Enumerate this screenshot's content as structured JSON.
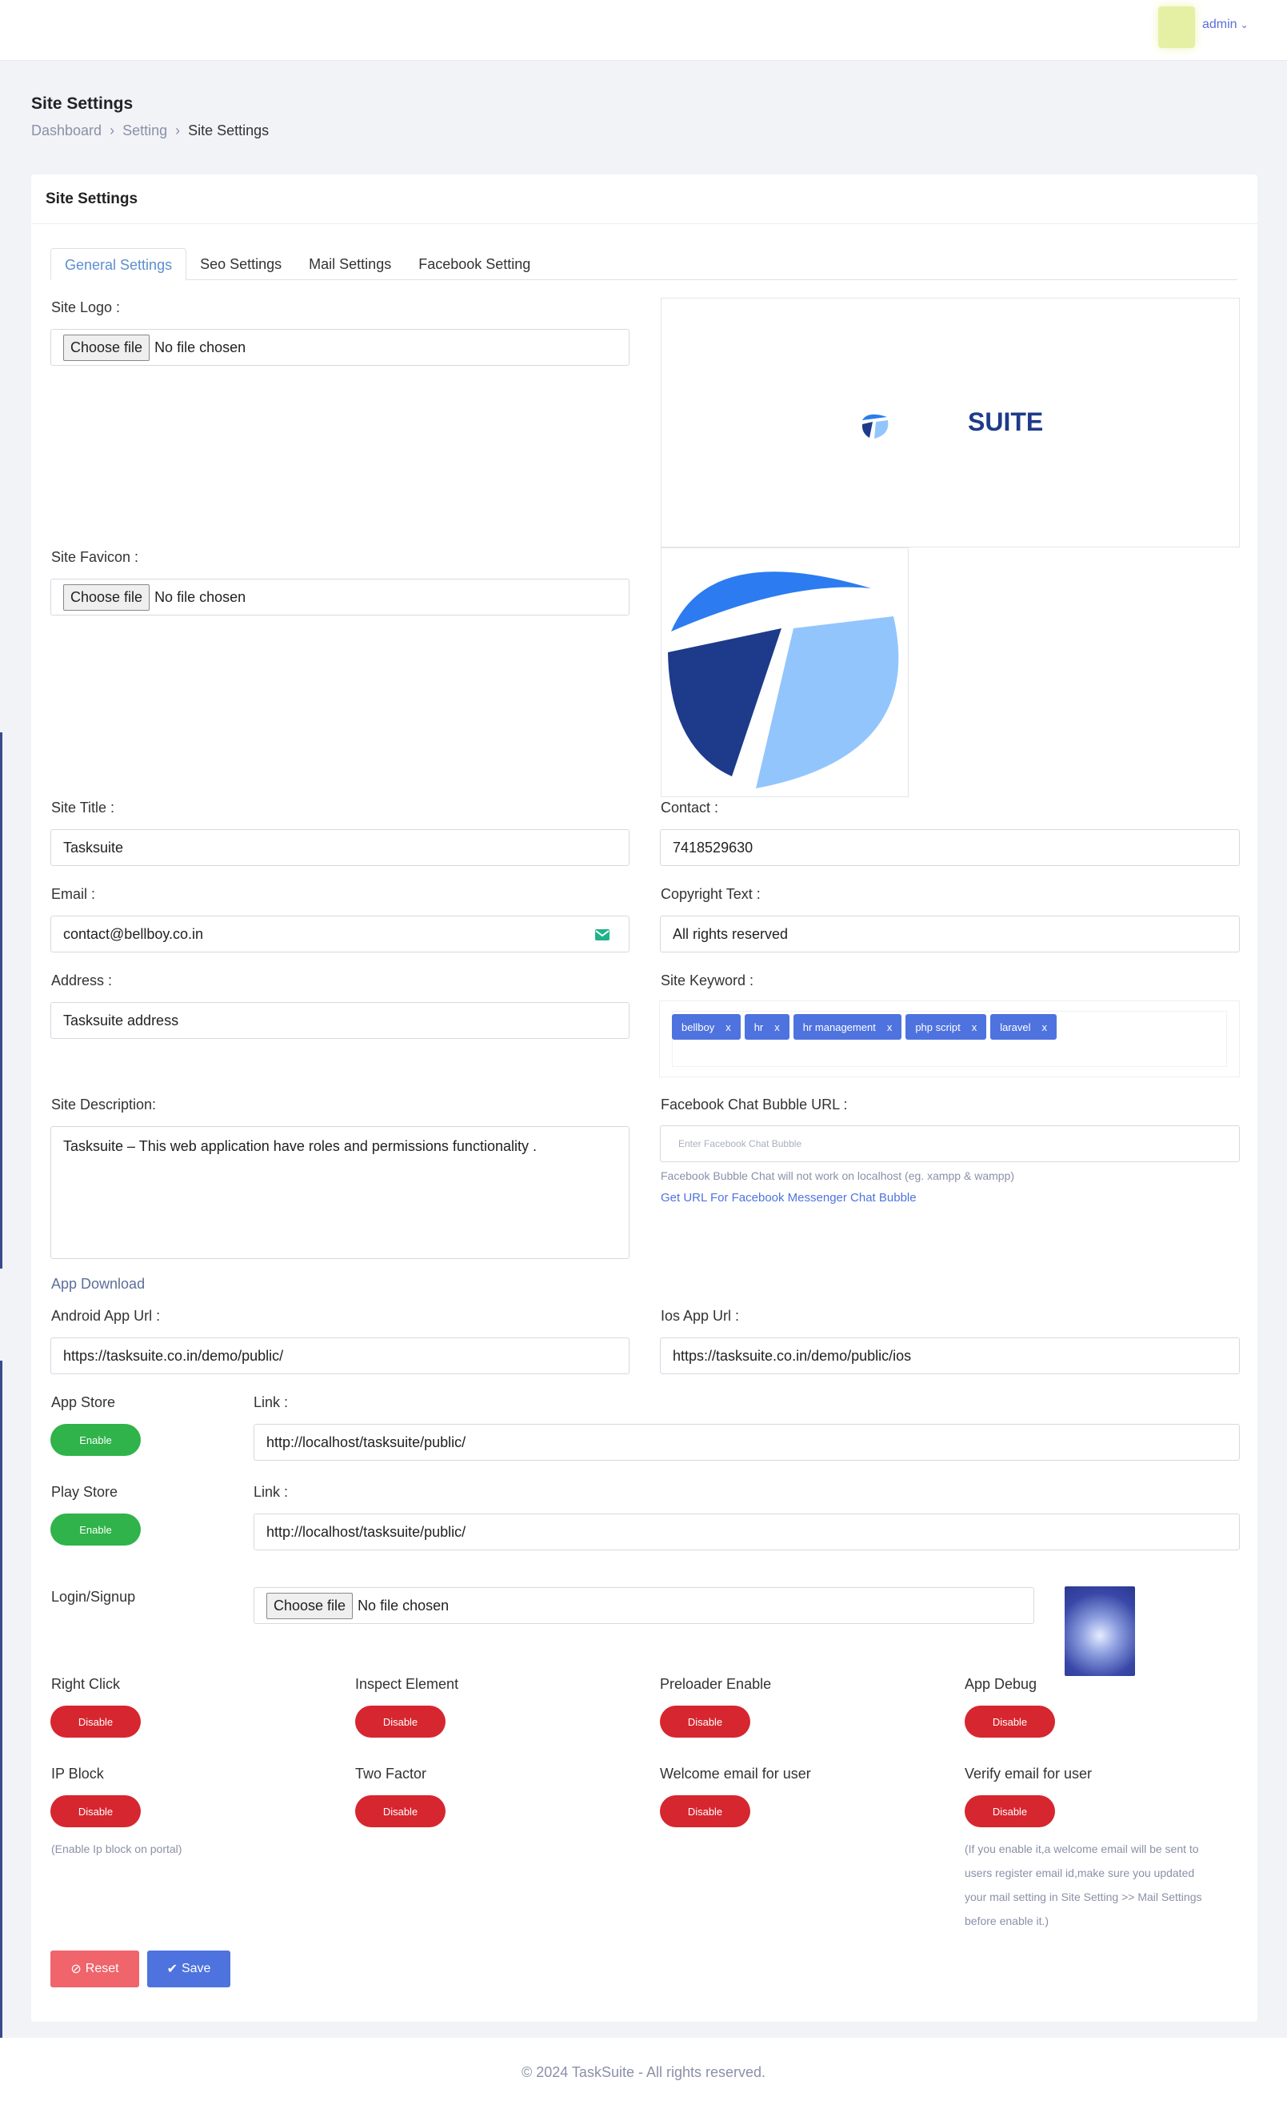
{
  "header": {
    "user": "admin"
  },
  "page": {
    "title": "Site Settings",
    "breadcrumb": [
      "Dashboard",
      "Setting",
      "Site Settings"
    ]
  },
  "card": {
    "title": "Site Settings"
  },
  "tabs": [
    "General Settings",
    "Seo Settings",
    "Mail Settings",
    "Facebook Setting"
  ],
  "file_input": {
    "button": "Choose file",
    "status": "No file chosen"
  },
  "logo": {
    "label": "Site Logo :",
    "wordmark": "SUITE"
  },
  "favicon": {
    "label": "Site Favicon :"
  },
  "site_title": {
    "label": "Site Title :",
    "value": "Tasksuite"
  },
  "contact": {
    "label": "Contact :",
    "value": "7418529630"
  },
  "email": {
    "label": "Email :",
    "value": "contact@bellboy.co.in"
  },
  "copyright": {
    "label": "Copyright Text :",
    "value": "All rights reserved"
  },
  "address": {
    "label": "Address :",
    "value": "Tasksuite address"
  },
  "keywords": {
    "label": "Site Keyword :",
    "tags": [
      "bellboy",
      "hr",
      "hr management",
      "php script",
      "laravel"
    ],
    "remove": "x"
  },
  "description": {
    "label": "Site Description:",
    "value": "Tasksuite – This web application have roles and permissions functionality ."
  },
  "fb_chat": {
    "label": "Facebook Chat Bubble URL :",
    "placeholder": "Enter Facebook Chat Bubble",
    "note": "Facebook Bubble Chat will not work on localhost (eg. xampp & wampp)",
    "link": "Get URL For Facebook Messenger Chat Bubble"
  },
  "app_download": {
    "heading": "App Download",
    "android_label": "Android App Url :",
    "android_value": "https://tasksuite.co.in/demo/public/",
    "ios_label": "Ios App Url :",
    "ios_value": "https://tasksuite.co.in/demo/public/ios"
  },
  "app_store": {
    "label": "App Store",
    "toggle": "Enable",
    "link_label": "Link :",
    "link": "http://localhost/tasksuite/public/"
  },
  "play_store": {
    "label": "Play Store",
    "toggle": "Enable",
    "link_label": "Link :",
    "link": "http://localhost/tasksuite/public/"
  },
  "login_signup": {
    "label": "Login/Signup"
  },
  "toggles": [
    {
      "label": "Right Click",
      "state": "Disable"
    },
    {
      "label": "Inspect Element",
      "state": "Disable"
    },
    {
      "label": "Preloader Enable",
      "state": "Disable"
    },
    {
      "label": "App Debug",
      "state": "Disable"
    },
    {
      "label": "IP Block",
      "state": "Disable"
    },
    {
      "label": "Two Factor",
      "state": "Disable"
    },
    {
      "label": "Welcome email for user",
      "state": "Disable"
    },
    {
      "label": "Verify email for user",
      "state": "Disable"
    }
  ],
  "ip_note": "(Enable Ip block on portal)",
  "verify_note": [
    "(If you enable it,a welcome email will be sent to",
    "users register email id,make sure you updated",
    "your mail setting in Site Setting >> Mail Settings",
    "before enable it.)"
  ],
  "actions": {
    "reset": "Reset",
    "save": "Save"
  },
  "footer": "© 2024 TaskSuite - All rights reserved.",
  "colors": {
    "primary": "#4e73df",
    "enable": "#2fb34a",
    "disable": "#d6262f",
    "reset": "#f0646c",
    "logo_dark": "#1e3a8a",
    "logo_light": "#93c5fd",
    "logo_mid": "#2c7bf0"
  }
}
